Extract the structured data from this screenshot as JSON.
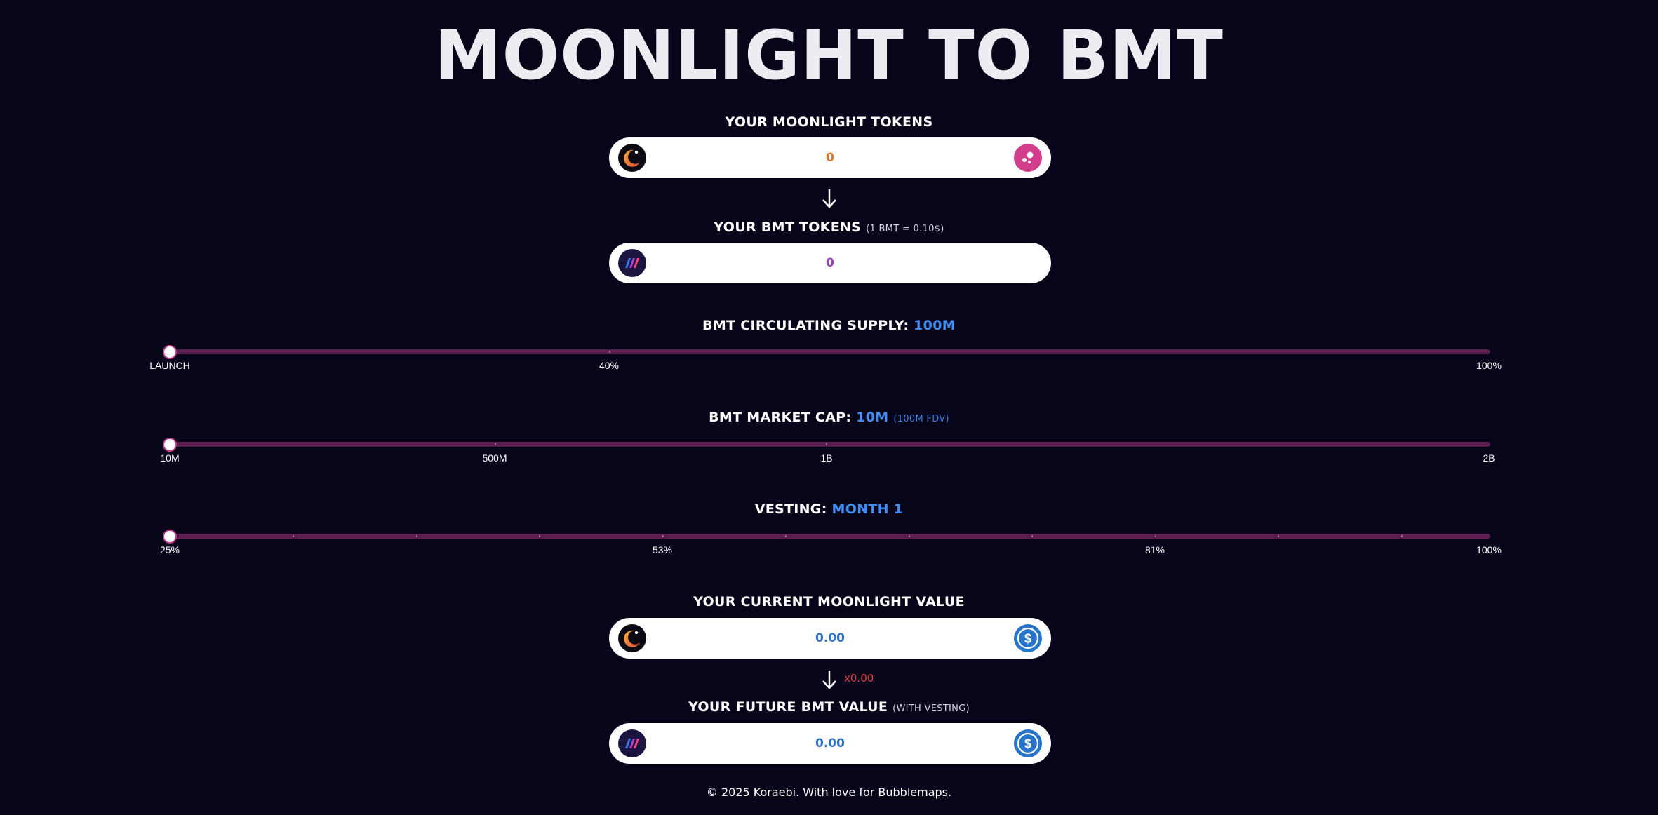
{
  "title": "MOONLIGHT TO BMT",
  "moonlight_tokens": {
    "label": "YOUR MOONLIGHT TOKENS",
    "value": "0",
    "left_icon": "moonlight-logo-icon",
    "right_icon": "bubblemaps-icon",
    "value_color": "#e8742a"
  },
  "bmt_tokens": {
    "label": "YOUR BMT TOKENS",
    "rate_note": "(1 BMT = 0.10$)",
    "value": "0",
    "left_icon": "bmt-logo-icon",
    "value_color": "#9b3fc0"
  },
  "supply": {
    "label": "BMT CIRCULATING SUPPLY:",
    "value": "100M",
    "ticks": [
      {
        "label": "LAUNCH",
        "fraction": 0
      },
      {
        "label": "40%",
        "fraction": 0.333
      },
      {
        "label": "100%",
        "fraction": 1
      }
    ],
    "slider_fraction": 0
  },
  "market_cap": {
    "label": "BMT MARKET CAP:",
    "value": "10M",
    "fdv": "(100M FDV)",
    "ticks": [
      {
        "label": "10M",
        "fraction": 0
      },
      {
        "label": "500M",
        "fraction": 0.246
      },
      {
        "label": "1B",
        "fraction": 0.497
      },
      {
        "label": "2B",
        "fraction": 1
      }
    ],
    "slider_fraction": 0
  },
  "vesting": {
    "label": "VESTING:",
    "value": "MONTH 1",
    "ticks": [
      {
        "label": "25%",
        "fraction": 0
      },
      {
        "label": "53%",
        "fraction": 0.3735
      },
      {
        "label": "81%",
        "fraction": 0.747
      },
      {
        "label": "100%",
        "fraction": 1
      }
    ],
    "slider_fraction": 0
  },
  "current_value": {
    "label": "YOUR CURRENT MOONLIGHT VALUE",
    "value": "0.00",
    "left_icon": "moonlight-logo-icon",
    "right_icon": "usdc-icon",
    "value_color": "#2f74c8"
  },
  "multiplier": "x0.00",
  "future_value": {
    "label": "YOUR FUTURE BMT VALUE",
    "note": "(WITH VESTING)",
    "value": "0.00",
    "left_icon": "bmt-logo-icon",
    "right_icon": "usdc-icon",
    "value_color": "#2f74c8"
  },
  "footer": {
    "copyright": "© 2025",
    "author": "Koraebi",
    "middle": ". With love for",
    "brand": "Bubblemaps",
    "end": "."
  },
  "colors": {
    "background": "#07051a",
    "track": "#5c1e4f",
    "accent_blue": "#3f8ef5",
    "multiplier_red": "#e23b3b"
  }
}
